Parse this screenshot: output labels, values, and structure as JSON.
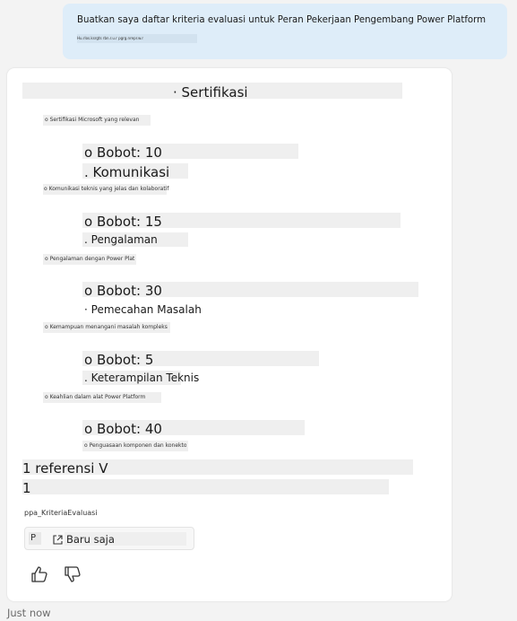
{
  "user_message": {
    "line1": "Buatkan saya daftar kriteria evaluasi untuk Peran Pekerjaan Pengembang Power Platform",
    "line2": "Hu.rlos.ksrgts rbn.r.u.r pgrg.nrepr.w.r"
  },
  "response": {
    "items": [
      {
        "title": "· Sertifikasi",
        "desc": "o Sertifikasi Microsoft yang relevan",
        "weight": "o Bobot: 10"
      },
      {
        "title": ". Komunikasi",
        "desc": "o Komunikasi teknis yang jelas dan kolaboratif",
        "weight": "o Bobot: 15"
      },
      {
        "title": ". Pengalaman",
        "desc": "o Pengalaman dengan Power Platform",
        "weight": "o Bobot: 30"
      },
      {
        "title": "· Pemecahan Masalah",
        "desc": "o Kemampuan menangani masalah kompleks",
        "weight": "o Bobot: 5"
      },
      {
        "title": ". Keterampilan Teknis",
        "desc": "o Keahlian dalam alat Power Platform",
        "weight": "o Bobot: 40"
      }
    ],
    "trailing_desc": "o Penguasaan komponen dan konektor",
    "references_label": "1 referensi V",
    "reference_number": "1",
    "reference_file": "ppa_KriteriaEvaluasi",
    "reference_pill_letter": "P",
    "reference_pill_time": "Baru saja"
  },
  "actions": {
    "like_icon": "thumbs-up-icon",
    "dislike_icon": "thumbs-down-icon"
  },
  "timestamp": "Just now"
}
